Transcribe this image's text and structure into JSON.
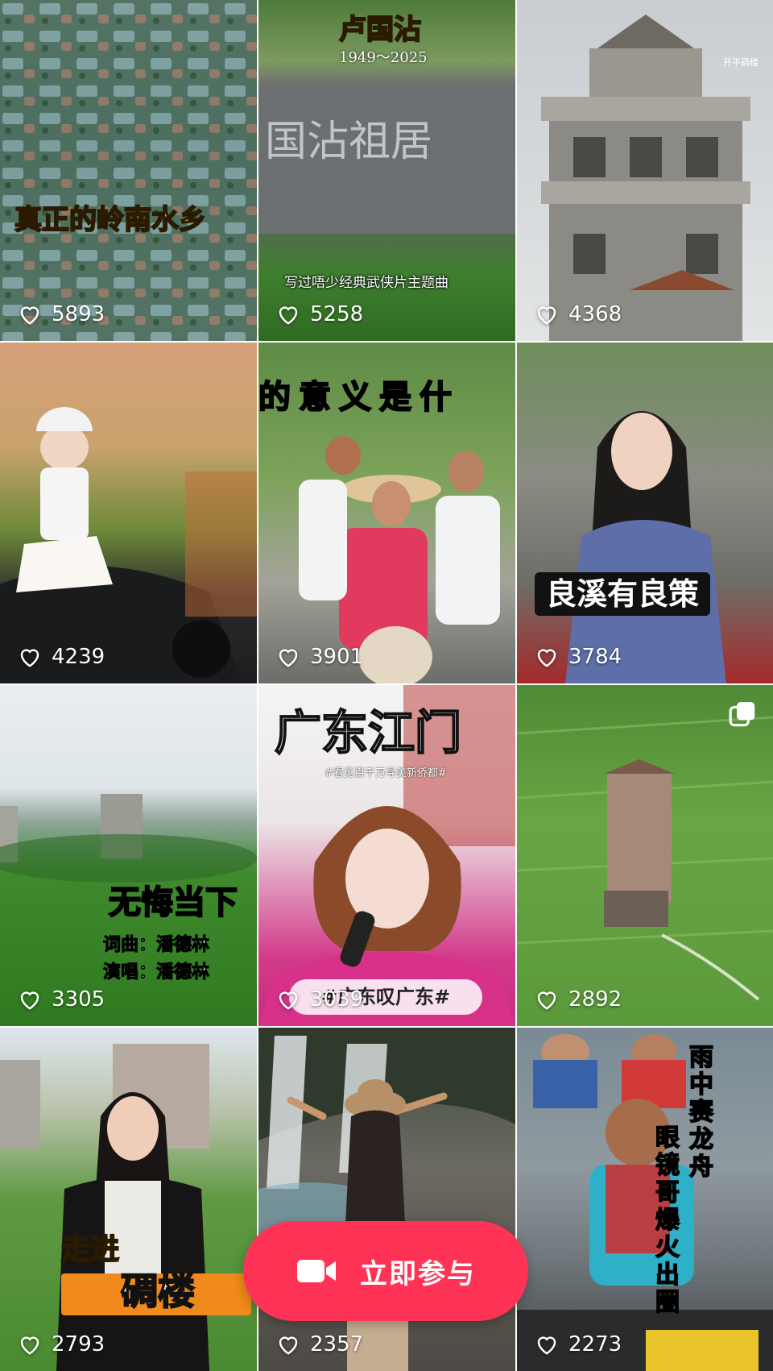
{
  "tiles": [
    {
      "caption": "真正的岭南水乡",
      "likes": "5893"
    },
    {
      "caption": "卢国沾",
      "caption_sub": "1949～2025",
      "sign_text": "国沾祖居",
      "footer_text": "写过唔少经典武侠片主题曲",
      "likes": "5258"
    },
    {
      "watermark": "开平碉楼",
      "likes": "4368"
    },
    {
      "likes": "4239"
    },
    {
      "caption": "的意义是什",
      "likes": "3901"
    },
    {
      "caption": "良溪有良策",
      "likes": "3784"
    },
    {
      "caption": "无悔当下",
      "credit_1": "词曲：潘德林",
      "credit_2": "演唱：潘德林",
      "likes": "3305"
    },
    {
      "caption": "广东江门",
      "caption_sub": "#看见百千万寻美新侨都#",
      "banner": "#广东叹广东#",
      "likes": "3039"
    },
    {
      "likes": "2892"
    },
    {
      "caption_1": "走进",
      "caption_2": "碉楼",
      "likes": "2793"
    },
    {
      "likes": "2357"
    },
    {
      "caption_1": "雨中赛龙舟",
      "caption_2": "眼镜哥爆火出圈",
      "likes": "2273"
    }
  ],
  "fab": {
    "label": "立即参与",
    "icon": "video-camera-icon"
  },
  "colors": {
    "accent": "#ff3355",
    "caption_yellow": "#ffe033"
  }
}
